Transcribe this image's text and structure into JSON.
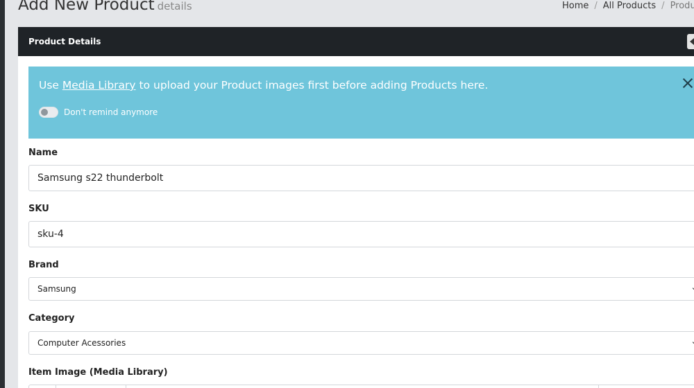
{
  "header": {
    "title": "Add New Product",
    "subtitle": "details"
  },
  "breadcrumb": [
    "Home",
    "All Products",
    "Products"
  ],
  "card": {
    "title": "Product Details"
  },
  "alert": {
    "prefix": "Use ",
    "link": "Media Library",
    "suffix": " to upload your Product images first before adding Products here.",
    "toggle_label": "Don't remind anymore",
    "toggle_on": false
  },
  "form": {
    "name_label": "Name",
    "name_value": "Samsung s22 thunderbolt",
    "sku_label": "SKU",
    "sku_value": "sku-4",
    "brand_label": "Brand",
    "brand_value": "Samsung",
    "category_label": "Category",
    "category_value": "Computer Acessories",
    "image_label": "Item Image (Media Library)"
  }
}
